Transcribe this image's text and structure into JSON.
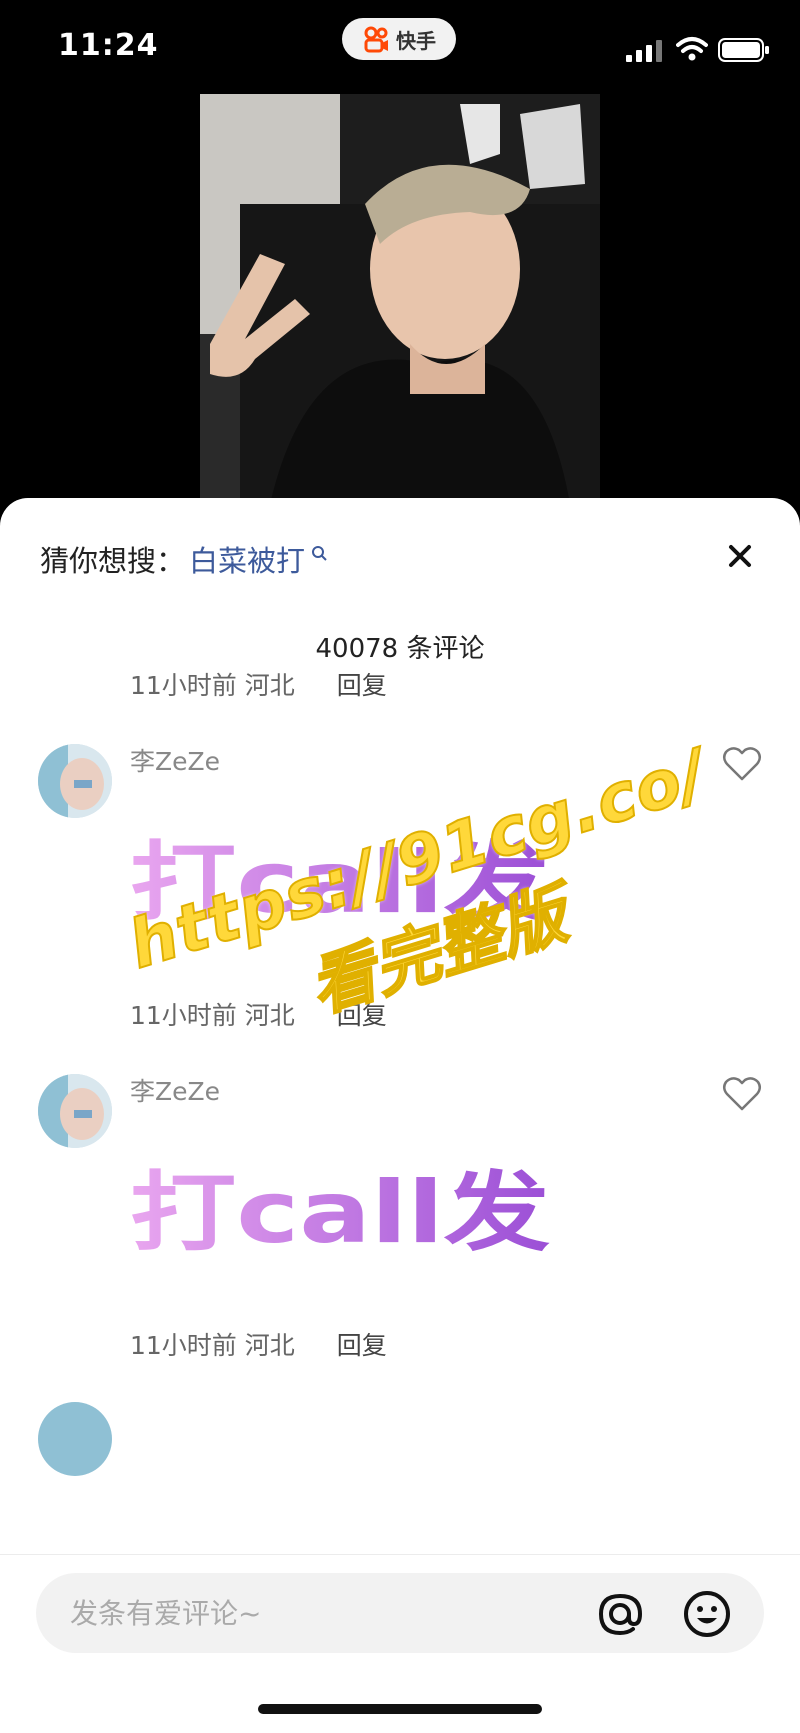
{
  "status_bar": {
    "time": "11:24",
    "app_name": "快手"
  },
  "sheet": {
    "suggest_label": "猜你想搜：",
    "suggest_keyword": "白菜被打",
    "comment_count": "40078 条评论"
  },
  "comments": [
    {
      "time": "11小时前",
      "location": "河北",
      "reply": "回复"
    },
    {
      "username": "李ZeZe",
      "sticker_text": "打call发",
      "time": "11小时前",
      "location": "河北",
      "reply": "回复"
    },
    {
      "username": "李ZeZe",
      "sticker_text": "打call发",
      "time": "11小时前",
      "location": "河北",
      "reply": "回复"
    }
  ],
  "watermark": {
    "line1": "https://91cg.co/",
    "line2": "看完整版"
  },
  "input": {
    "placeholder": "发条有爱评论~"
  },
  "icons": [
    "kuaishou-logo-icon",
    "signal-icon",
    "wifi-icon",
    "battery-icon",
    "search-icon",
    "close-icon",
    "heart-icon",
    "at-icon",
    "emoji-icon"
  ],
  "colors": {
    "keyword": "#3d5a9b",
    "watermark": "#ffd83a",
    "sticker_gradient_start": "#e9a6ef",
    "sticker_gradient_end": "#9b4fd6",
    "kuaishou_orange": "#ff4906"
  }
}
